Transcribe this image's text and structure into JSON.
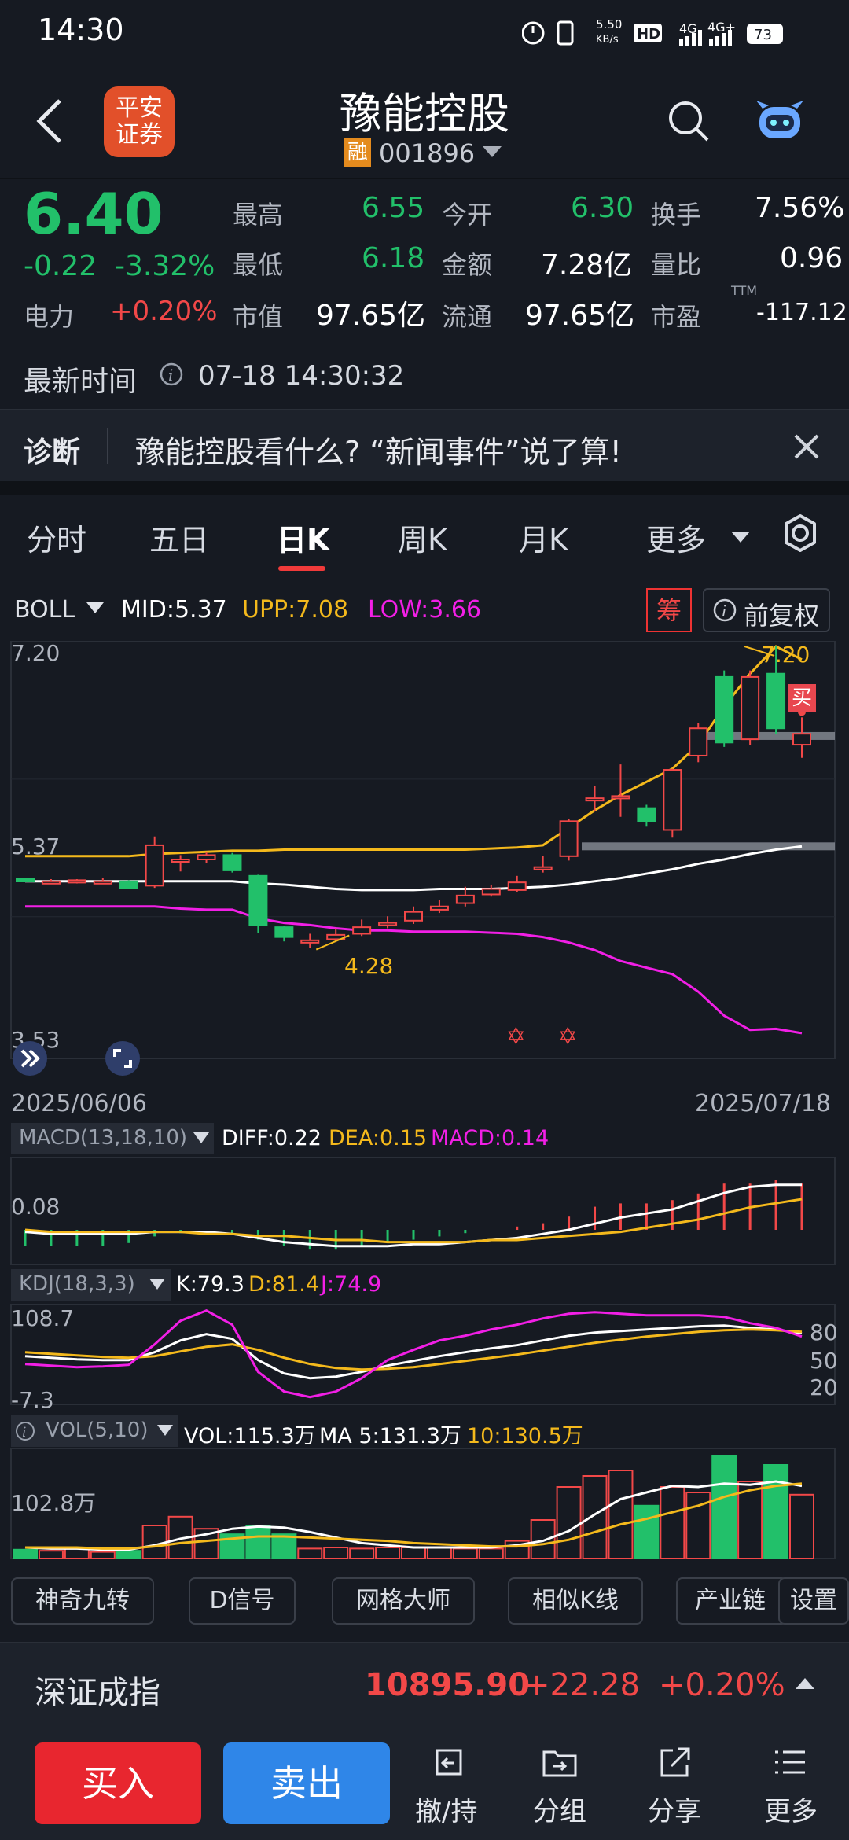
{
  "status": {
    "time": "14:30",
    "net_speed": "5.50\nKB/s",
    "hd": "HD",
    "sim_a": "4G",
    "sim_b": "4G+",
    "battery": "73"
  },
  "header": {
    "logo_line1": "平安",
    "logo_line2": "证券",
    "title": "豫能控股",
    "rong": "融",
    "code": "001896"
  },
  "quote": {
    "price": "6.40",
    "change": "-0.22",
    "change_pct": "-3.32%",
    "sector": "电力",
    "sector_pct": "+0.20%",
    "high_lbl": "最高",
    "high": "6.55",
    "open_lbl": "今开",
    "open": "6.30",
    "turn_lbl": "换手",
    "turn": "7.56%",
    "low_lbl": "最低",
    "low": "6.18",
    "amount_lbl": "金额",
    "amount": "7.28亿",
    "ratio_lbl": "量比",
    "ratio": "0.96",
    "mcap_lbl": "市值",
    "mcap": "97.65亿",
    "float_lbl": "流通",
    "float": "97.65亿",
    "pe_lbl": "市盈",
    "pe_sup": "TTM",
    "pe": "-117.12",
    "latest_lbl": "最新时间",
    "latest": "07-18 14:30:32"
  },
  "diagnosis": {
    "label": "诊断",
    "text": "豫能控股看什么? “新闻事件”说了算!"
  },
  "tabs": [
    "分时",
    "五日",
    "日K",
    "周K",
    "月K",
    "更多"
  ],
  "boll": {
    "name": "BOLL",
    "mid": "MID:5.37",
    "upp": "UPP:7.08",
    "low": "LOW:3.66",
    "chou": "筹",
    "fq": "前复权"
  },
  "kchart": {
    "y_top": "7.20",
    "y_mid": "5.37",
    "y_bot": "3.53",
    "hi_mark": "7.20",
    "lo_mark": "4.28",
    "buy_tag": "买",
    "date_start": "2025/06/06",
    "date_end": "2025/07/18"
  },
  "macd": {
    "name": "MACD(13,18,10)",
    "diff": "DIFF:0.22",
    "dea": "DEA:0.15",
    "macd": "MACD:0.14",
    "y": "0.08"
  },
  "kdj": {
    "name": "KDJ(18,3,3)",
    "k": "K:79.3",
    "d": "D:81.4",
    "j": "J:74.9",
    "y_top": "108.7",
    "y_bot": "-7.3",
    "r80": "80",
    "r50": "50",
    "r20": "20"
  },
  "vol": {
    "name": "VOL(5,10)",
    "vol": "VOL:115.3万",
    "ma5": "MA 5:131.3万",
    "ma10": "10:130.5万",
    "y": "102.8万"
  },
  "tools": [
    "神奇九转",
    "D信号",
    "网格大师",
    "相似K线",
    "产业链",
    "设置"
  ],
  "index": {
    "name": "深证成指",
    "value": "10895.90",
    "change": "+22.28",
    "pct": "+0.20%"
  },
  "bottom": {
    "buy": "买入",
    "sell": "卖出",
    "cancel": "撤/持",
    "group": "分组",
    "share": "分享",
    "more": "更多"
  },
  "colors": {
    "up": "#f24848",
    "down": "#22c06a",
    "mid": "#ffffff",
    "upp": "#f4b91c",
    "low": "#f21fe6"
  },
  "chart_data": {
    "type": "candlestick",
    "x_start": "2025/06/06",
    "x_end": "2025/07/18",
    "ylim": [
      3.53,
      7.2
    ],
    "candles": [
      {
        "o": 5.07,
        "c": 5.06,
        "h": 5.08,
        "l": 5.05
      },
      {
        "o": 5.05,
        "c": 5.05,
        "h": 5.07,
        "l": 5.03
      },
      {
        "o": 5.04,
        "c": 5.06,
        "h": 5.07,
        "l": 5.03
      },
      {
        "o": 5.05,
        "c": 5.05,
        "h": 5.08,
        "l": 5.04
      },
      {
        "o": 5.05,
        "c": 4.99,
        "h": 5.06,
        "l": 4.98
      },
      {
        "o": 5.01,
        "c": 5.38,
        "h": 5.46,
        "l": 4.99
      },
      {
        "o": 5.25,
        "c": 5.25,
        "h": 5.29,
        "l": 5.14
      },
      {
        "o": 5.25,
        "c": 5.29,
        "h": 5.32,
        "l": 5.22
      },
      {
        "o": 5.29,
        "c": 5.15,
        "h": 5.31,
        "l": 5.13
      },
      {
        "o": 5.1,
        "c": 4.65,
        "h": 5.11,
        "l": 4.58
      },
      {
        "o": 4.63,
        "c": 4.54,
        "h": 4.64,
        "l": 4.5
      },
      {
        "o": 4.49,
        "c": 4.51,
        "h": 4.57,
        "l": 4.44
      },
      {
        "o": 4.52,
        "c": 4.56,
        "h": 4.62,
        "l": 4.5
      },
      {
        "o": 4.57,
        "c": 4.63,
        "h": 4.7,
        "l": 4.55
      },
      {
        "o": 4.65,
        "c": 4.67,
        "h": 4.73,
        "l": 4.62
      },
      {
        "o": 4.69,
        "c": 4.77,
        "h": 4.82,
        "l": 4.66
      },
      {
        "o": 4.79,
        "c": 4.82,
        "h": 4.88,
        "l": 4.76
      },
      {
        "o": 4.85,
        "c": 4.92,
        "h": 5.0,
        "l": 4.82
      },
      {
        "o": 4.93,
        "c": 4.98,
        "h": 5.02,
        "l": 4.91
      },
      {
        "o": 4.97,
        "c": 5.04,
        "h": 5.1,
        "l": 4.95
      },
      {
        "o": 5.16,
        "c": 5.18,
        "h": 5.28,
        "l": 5.13
      },
      {
        "o": 5.28,
        "c": 5.6,
        "h": 5.62,
        "l": 5.24
      },
      {
        "o": 5.81,
        "c": 5.81,
        "h": 5.92,
        "l": 5.69
      },
      {
        "o": 5.83,
        "c": 5.83,
        "h": 6.12,
        "l": 5.64
      },
      {
        "o": 5.72,
        "c": 5.6,
        "h": 5.75,
        "l": 5.55
      },
      {
        "o": 5.52,
        "c": 6.07,
        "h": 6.08,
        "l": 5.45
      },
      {
        "o": 6.2,
        "c": 6.45,
        "h": 6.5,
        "l": 6.14
      },
      {
        "o": 6.92,
        "c": 6.32,
        "h": 6.98,
        "l": 6.28
      },
      {
        "o": 6.35,
        "c": 6.92,
        "h": 6.98,
        "l": 6.3
      },
      {
        "o": 6.95,
        "c": 6.45,
        "h": 7.2,
        "l": 6.4
      },
      {
        "o": 6.3,
        "c": 6.4,
        "h": 6.55,
        "l": 6.18
      }
    ],
    "mid": [
      5.05,
      5.05,
      5.05,
      5.05,
      5.05,
      5.05,
      5.05,
      5.05,
      5.05,
      5.03,
      5.02,
      5.0,
      4.98,
      4.97,
      4.97,
      4.97,
      4.98,
      4.98,
      4.98,
      4.99,
      5.0,
      5.02,
      5.05,
      5.08,
      5.12,
      5.16,
      5.21,
      5.25,
      5.3,
      5.34,
      5.37
    ],
    "upp": [
      5.28,
      5.28,
      5.28,
      5.28,
      5.28,
      5.3,
      5.31,
      5.32,
      5.33,
      5.33,
      5.34,
      5.34,
      5.34,
      5.34,
      5.34,
      5.34,
      5.34,
      5.34,
      5.35,
      5.36,
      5.38,
      5.54,
      5.7,
      5.84,
      5.96,
      6.08,
      6.3,
      6.65,
      6.95,
      7.2,
      7.08
    ],
    "low": [
      4.82,
      4.82,
      4.82,
      4.82,
      4.82,
      4.82,
      4.8,
      4.79,
      4.79,
      4.71,
      4.67,
      4.65,
      4.62,
      4.6,
      4.6,
      4.59,
      4.59,
      4.59,
      4.58,
      4.57,
      4.54,
      4.49,
      4.42,
      4.32,
      4.26,
      4.2,
      4.04,
      3.82,
      3.69,
      3.7,
      3.66
    ],
    "support_bands": [
      6.38,
      5.37
    ]
  }
}
